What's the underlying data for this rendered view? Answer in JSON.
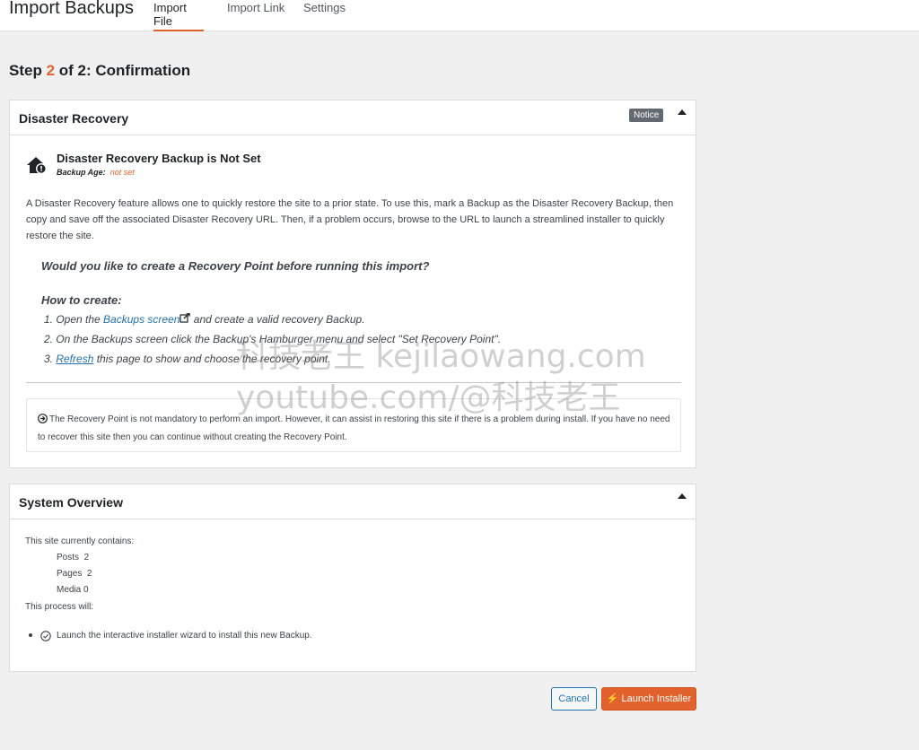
{
  "header": {
    "title": "Import Backups",
    "tabs": [
      {
        "label": "Import File",
        "active": true
      },
      {
        "label": "Import Link",
        "active": false
      },
      {
        "label": "Settings",
        "active": false
      }
    ]
  },
  "step": {
    "prefix": "Step ",
    "current": "2",
    "suffix": " of 2: Confirmation"
  },
  "disaster_recovery": {
    "title": "Disaster Recovery",
    "badge": "Notice",
    "heading": "Disaster Recovery Backup is Not Set",
    "age_label": "Backup Age:",
    "age_value": "not set",
    "description": "A Disaster Recovery feature allows one to quickly restore the site to a prior state. To use this, mark a Backup as the Disaster Recovery Backup, then copy and save off the associated Disaster Recovery URL. Then, if a problem occurs, browse to the URL to launch a streamlined installer to quickly restore the site.",
    "question": "Would you like to create a Recovery Point before running this import?",
    "how_to": "How to create:",
    "step1_pre": "1. Open the ",
    "step1_link": "Backups screen",
    "step1_post": " and create a valid recovery Backup.",
    "step2": "2. On the Backups screen click the Backup's Hamburger menu and select \"Set Recovery Point\".",
    "step3_pre": "3. ",
    "step3_link": "Refresh",
    "step3_post": " this page to show and choose the recovery point.",
    "note": "The Recovery Point is not mandatory to perform an import. However, it can assist in restoring this site if there is a problem during install. If you have no need to recover this site then you can continue without creating the Recovery Point."
  },
  "system_overview": {
    "title": "System Overview",
    "contains_label": "This site currently contains:",
    "items": [
      {
        "label": "Posts",
        "count": "2"
      },
      {
        "label": "Pages",
        "count": "2"
      },
      {
        "label": "Media",
        "count": "0"
      }
    ],
    "process_label": "This process will:",
    "action": "Launch the interactive installer wizard to install this new Backup."
  },
  "buttons": {
    "cancel": "Cancel",
    "launch": "Launch Installer"
  },
  "watermark": {
    "line1": "科技老王 kejilaowang.com",
    "line2": "youtube.com/@科技老王"
  },
  "colors": {
    "accent": "#e2622d",
    "link": "#2271b1"
  }
}
